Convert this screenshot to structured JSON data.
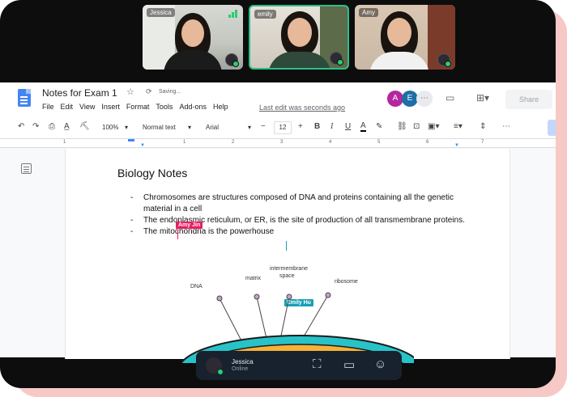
{
  "participants": [
    {
      "name": "Jessica"
    },
    {
      "name": "emily"
    },
    {
      "name": "Amy"
    }
  ],
  "doc": {
    "title": "Notes for Exam 1",
    "saving_status": "Saving...",
    "last_edit": "Last edit was seconds ago",
    "share_label": "Share",
    "menu": [
      "File",
      "Edit",
      "View",
      "Insert",
      "Format",
      "Tools",
      "Add-ons",
      "Help"
    ],
    "collaborators": [
      {
        "initial": "A",
        "color": "#b3279f"
      },
      {
        "initial": "E",
        "color": "#1d6fa5"
      }
    ]
  },
  "toolbar": {
    "zoom": "100%",
    "style": "Normal text",
    "font": "Arial",
    "font_size": "12",
    "minus": "−",
    "plus": "+"
  },
  "ruler": {
    "marks": [
      "1",
      "1",
      "2",
      "3",
      "4",
      "5",
      "6",
      "7"
    ]
  },
  "content": {
    "heading": "Biology Notes",
    "bullets": [
      "Chromosomes are structures composed of DNA and proteins containing all the genetic material in a cell",
      "The endoplasmic reticulum, or ER, is the site of production of all transmembrane proteins.",
      "The mitochondria is the powerhouse"
    ],
    "cursors": [
      {
        "name": "Amy Jin",
        "color": "#e91e63"
      },
      {
        "name": "Emily Hu",
        "color": "#1a9fb5"
      }
    ],
    "diagram_labels": {
      "dna": "DNA",
      "matrix": "matrix",
      "intermembrane": "intermembrane",
      "space": "space",
      "ribosome": "ribosome"
    }
  },
  "bottom": {
    "user": "Jessica",
    "status": "Online"
  }
}
